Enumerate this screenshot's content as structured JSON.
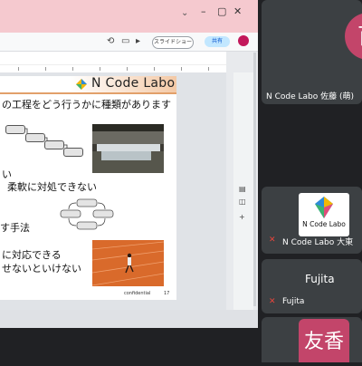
{
  "browser": {
    "slideshow_label": "スライドショー",
    "share_label": "共有"
  },
  "slide": {
    "logo_text": "N Code Labo",
    "line1": "の工程をどう行うかに種類があります",
    "line2": "い",
    "line3": "柔軟に対処できない",
    "line4": "す手法",
    "line5": "に対応できる",
    "line6": "せないといけない",
    "footer_label": "confidential",
    "page_number": "17"
  },
  "participants": [
    {
      "initial": "百",
      "name": "N Code Labo 佐藤 (萌)"
    },
    {
      "logo_text": "N Code Labo",
      "name": "N Code Labo 大東"
    },
    {
      "display_name": "Fujita",
      "name": "Fujita"
    },
    {
      "initial": "友香"
    }
  ],
  "colors": {
    "avatar_pink": "#c3456a",
    "panel_bg": "#3c4043",
    "meet_bg": "#202124",
    "mic_off_red": "#e8453c"
  }
}
